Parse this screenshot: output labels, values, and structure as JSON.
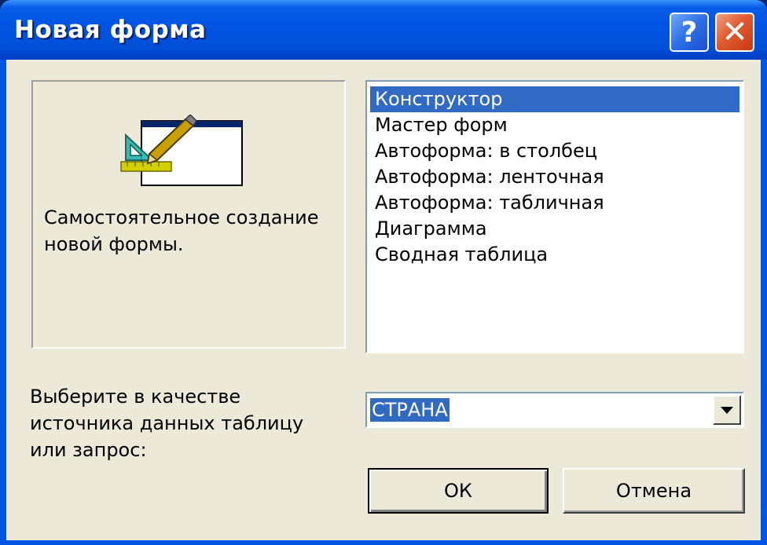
{
  "window": {
    "title": "Новая форма",
    "help_label": "?",
    "close_label": "✕"
  },
  "preview": {
    "icon": "form-design-icon",
    "description": "Самостоятельное создание новой формы."
  },
  "form_types": {
    "selected_index": 0,
    "items": [
      "Конструктор",
      "Мастер форм",
      "Автоформа: в столбец",
      "Автоформа: ленточная",
      "Автоформа: табличная",
      "Диаграмма",
      "Сводная таблица"
    ]
  },
  "source": {
    "label": "Выберите в качестве источника данных таблицу или запрос:",
    "value": "СТРАНА"
  },
  "buttons": {
    "ok_label": "ОК",
    "cancel_label": "Отмена"
  },
  "colors": {
    "titlebar": "#0054e3",
    "selection": "#316ac5",
    "dialog_bg": "#ece9d8"
  }
}
